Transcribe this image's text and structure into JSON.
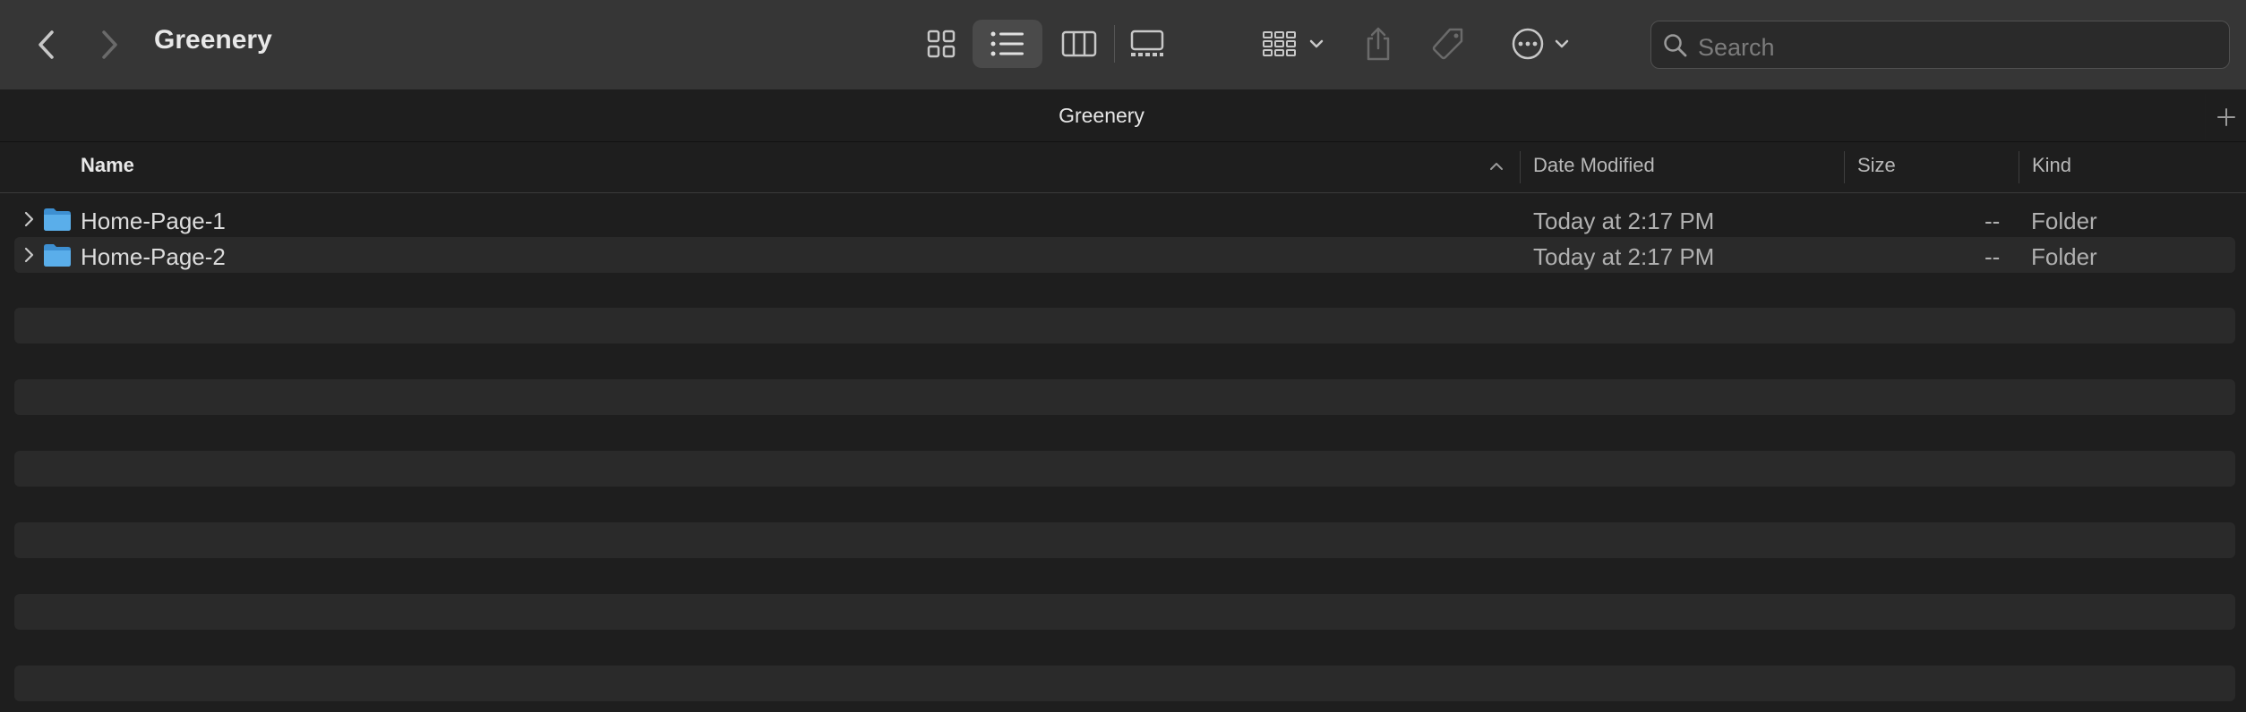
{
  "window": {
    "title": "Greenery"
  },
  "toolbar": {
    "back_icon": "chevron-left-icon",
    "forward_icon": "chevron-right-icon",
    "views": [
      "icon-view-icon",
      "list-view-icon",
      "column-view-icon",
      "gallery-view-icon"
    ],
    "active_view": "list-view-icon",
    "search_placeholder": "Search"
  },
  "tab": {
    "title": "Greenery"
  },
  "columns": {
    "name": "Name",
    "date": "Date Modified",
    "size": "Size",
    "kind": "Kind"
  },
  "rows": [
    {
      "name": "Home-Page-1",
      "date": "Today at 2:17 PM",
      "size": "--",
      "kind": "Folder"
    },
    {
      "name": "Home-Page-2",
      "date": "Today at 2:17 PM",
      "size": "--",
      "kind": "Folder"
    }
  ],
  "colors": {
    "folder": "#5aaeea",
    "toolbar": "#363636",
    "background": "#1e1e1e",
    "stripe": "#2a2a2a"
  }
}
